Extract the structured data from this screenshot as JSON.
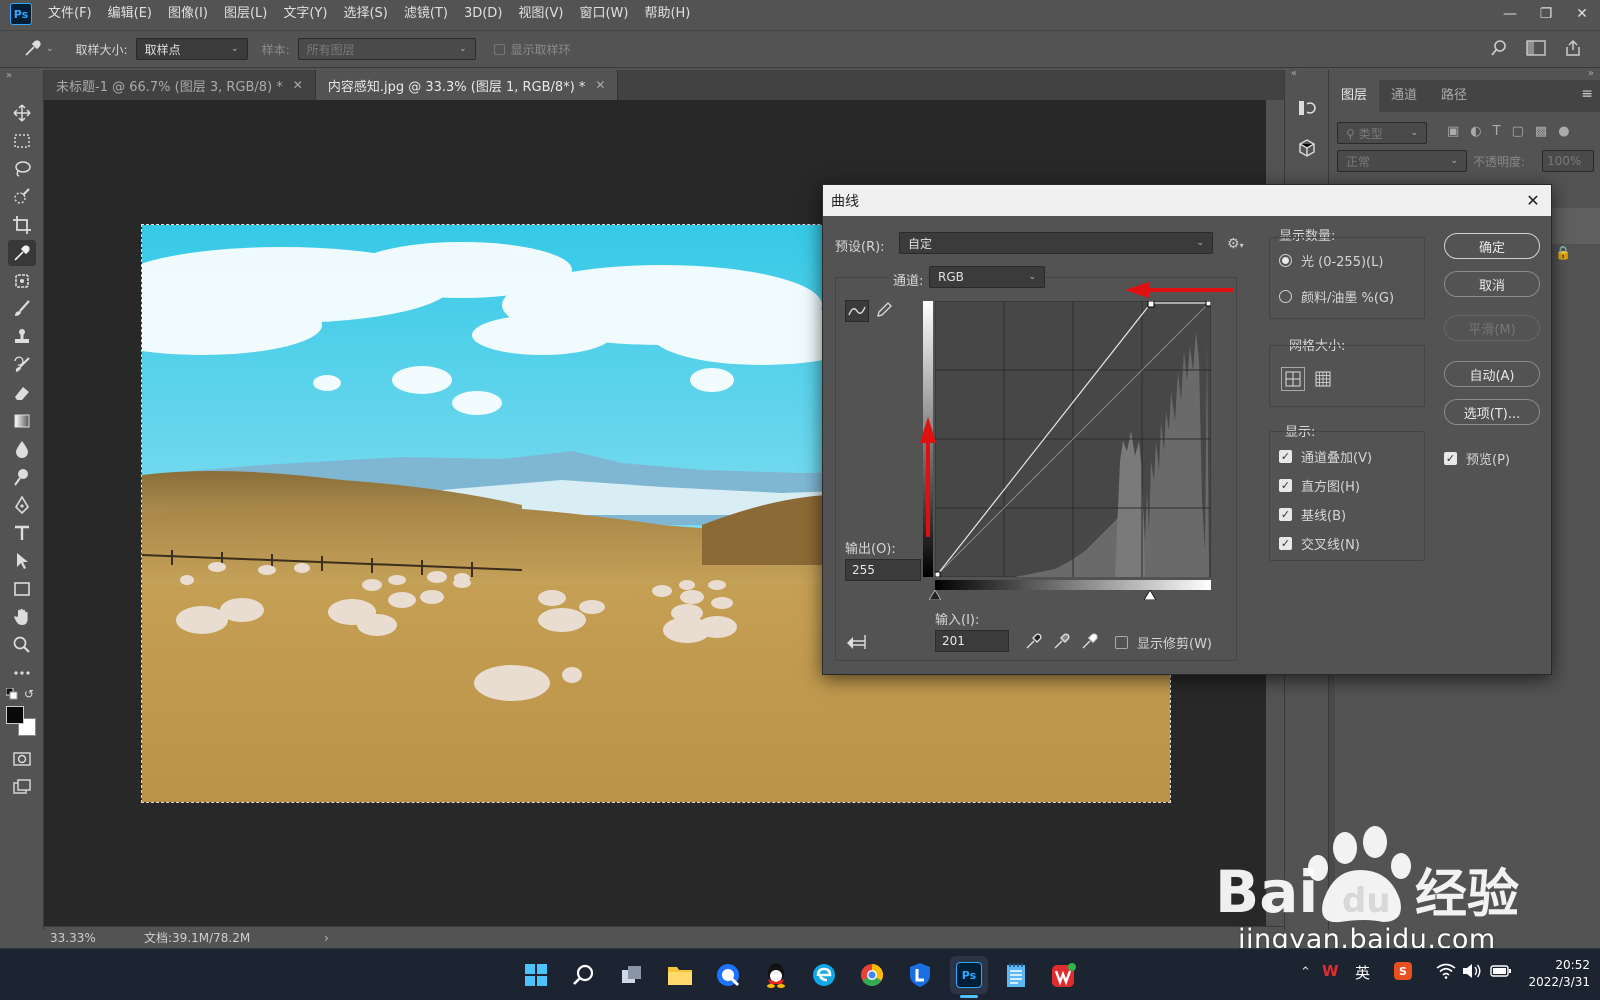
{
  "app": {
    "logo": "Ps"
  },
  "menu": [
    "文件(F)",
    "编辑(E)",
    "图像(I)",
    "图层(L)",
    "文字(Y)",
    "选择(S)",
    "滤镜(T)",
    "3D(D)",
    "视图(V)",
    "窗口(W)",
    "帮助(H)"
  ],
  "options": {
    "sample_size_label": "取样大小:",
    "sample_size_value": "取样点",
    "sample_label": "样本:",
    "sample_value": "所有图层",
    "show_ring_label": "显示取样环"
  },
  "tabs": [
    {
      "label": "未标题-1 @ 66.7% (图层 3, RGB/8) *"
    },
    {
      "label": "内容感知.jpg @ 33.3% (图层 1, RGB/8*) *"
    }
  ],
  "panels": {
    "tabs": [
      "图层",
      "通道",
      "路径"
    ],
    "filter_placeholder": "类型",
    "blend_mode": "正常",
    "opacity_label": "不透明度:",
    "opacity_value": "100%"
  },
  "status": {
    "zoom": "33.33%",
    "doc": "文档:39.1M/78.2M"
  },
  "dialog": {
    "title": "曲线",
    "preset_label": "预设(R):",
    "preset_value": "自定",
    "channel_label": "通道:",
    "channel_value": "RGB",
    "output_label": "输出(O):",
    "output_value": "255",
    "input_label": "输入(I):",
    "input_value": "201",
    "show_clipping": "显示修剪(W)",
    "display_amount_label": "显示数量:",
    "light_option": "光 (0-255)(L)",
    "pigment_option": "颜料/油墨 %(G)",
    "grid_size_label": "网格大小:",
    "show_label": "显示:",
    "show_options": [
      "通道叠加(V)",
      "直方图(H)",
      "基线(B)",
      "交叉线(N)"
    ],
    "buttons": {
      "ok": "确定",
      "cancel": "取消",
      "smooth": "平滑(M)",
      "auto": "自动(A)",
      "options": "选项(T)..."
    },
    "preview": "预览(P)"
  },
  "taskbar": {
    "ime": "英",
    "time": "20:52",
    "date": "2022/3/31"
  },
  "watermark": {
    "url": "jingyan.baidu.com"
  },
  "colors": {
    "accent_red": "#e01010",
    "ps_blue": "#31a8ff"
  }
}
